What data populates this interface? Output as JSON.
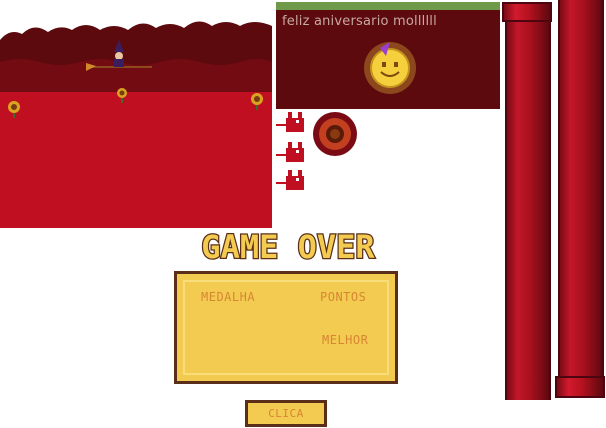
{
  "banner": {
    "message": "feliz aniversario mollllll"
  },
  "game_over": {
    "title": "GAME OVER"
  },
  "score_panel": {
    "medal_label": "MEDALHA",
    "points_label": "PONTOS",
    "best_label": "MELHOR"
  },
  "button": {
    "label": "CLICA"
  },
  "colors": {
    "scene_red": "#c10f22",
    "scene_dark": "#5c0a0e",
    "panel_yellow": "#f2cb50",
    "panel_border": "#5a2e18",
    "label_orange": "#d88634",
    "pipe_red": "#b4111f"
  },
  "icons": [
    "witch-on-broom-icon",
    "sunflower-icon",
    "devil-cat-icon",
    "smiley-sun-icon",
    "party-hat-icon"
  ]
}
